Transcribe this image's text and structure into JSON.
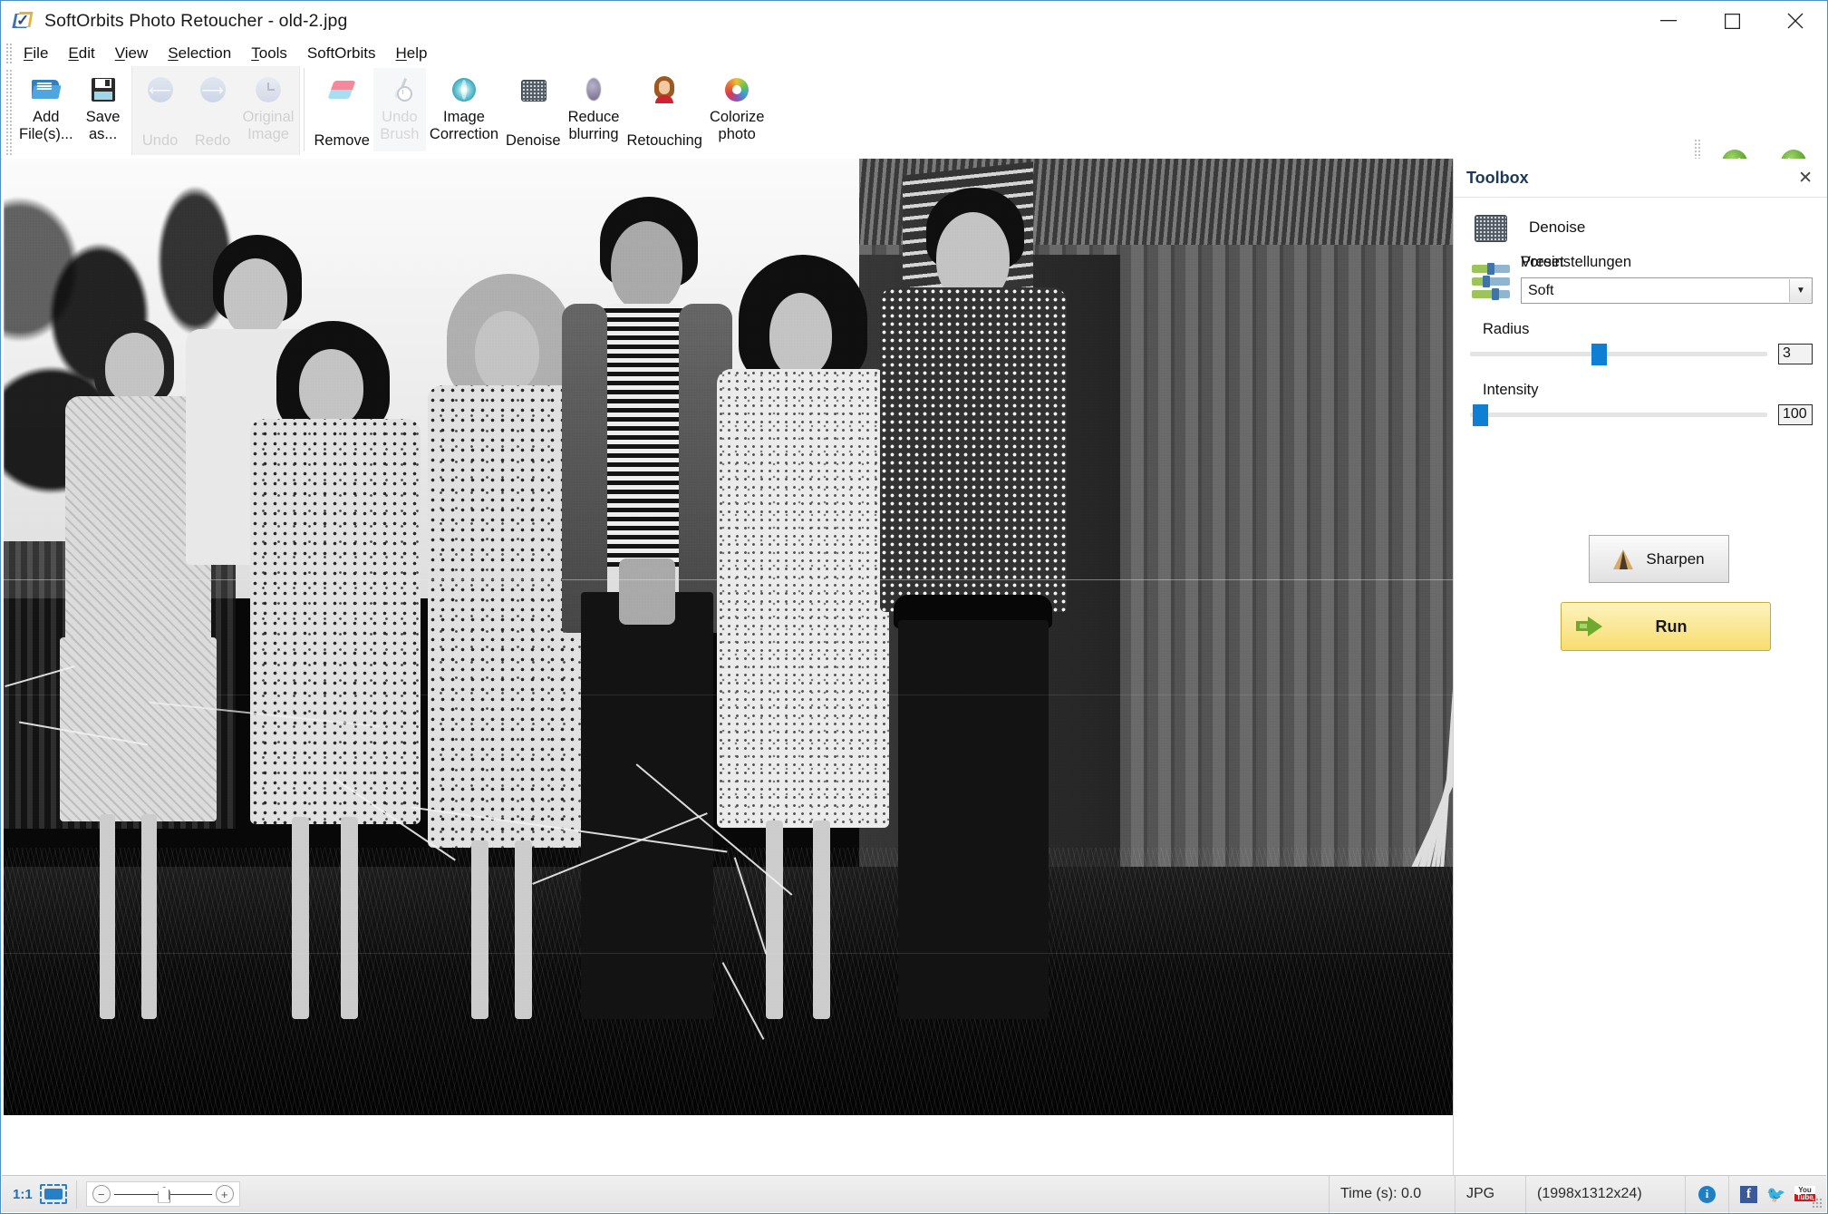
{
  "window": {
    "title": "SoftOrbits Photo Retoucher - old-2.jpg",
    "app_icon": "softorbits-logo-icon",
    "minimize": "—",
    "maximize": "☐",
    "close": "✕"
  },
  "menu": {
    "items": [
      {
        "label": "File",
        "accel": "F"
      },
      {
        "label": "Edit",
        "accel": "E"
      },
      {
        "label": "View",
        "accel": "V"
      },
      {
        "label": "Selection",
        "accel": "S"
      },
      {
        "label": "Tools",
        "accel": "T"
      },
      {
        "label": "SoftOrbits",
        "accel": ""
      },
      {
        "label": "Help",
        "accel": "H"
      }
    ]
  },
  "toolbar": {
    "buttons": [
      {
        "label": "Add\nFile(s)...",
        "line1": "Add",
        "line2": "File(s)...",
        "icon": "open-folder-icon",
        "disabled": false
      },
      {
        "label": "Save as...",
        "line1": "Save",
        "line2": "as...",
        "icon": "floppy-save-icon",
        "disabled": false
      },
      {
        "label": "Undo",
        "line1": "",
        "line2": "Undo",
        "icon": "undo-arrow-icon",
        "disabled": true
      },
      {
        "label": "Redo",
        "line1": "",
        "line2": "Redo",
        "icon": "redo-arrow-icon",
        "disabled": true
      },
      {
        "label": "Original Image",
        "line1": "Original",
        "line2": "Image",
        "icon": "history-clock-icon",
        "disabled": true
      },
      {
        "label": "Remove",
        "line1": "",
        "line2": "Remove",
        "icon": "eraser-icon",
        "disabled": false
      },
      {
        "label": "Undo Brush",
        "line1": "Undo",
        "line2": "Brush",
        "icon": "undo-brush-icon",
        "disabled": true
      },
      {
        "label": "Image Correction",
        "line1": "Image",
        "line2": "Correction",
        "icon": "image-correction-gem-icon",
        "disabled": false
      },
      {
        "label": "Denoise",
        "line1": "",
        "line2": "Denoise",
        "icon": "denoise-noise-icon",
        "disabled": false
      },
      {
        "label": "Reduce blurring",
        "line1": "Reduce",
        "line2": "blurring",
        "icon": "reduce-blur-icon",
        "disabled": false
      },
      {
        "label": "Retouching",
        "line1": "",
        "line2": "Retouching",
        "icon": "retouching-portrait-icon",
        "disabled": false
      },
      {
        "label": "Colorize photo",
        "line1": "Colorize",
        "line2": "photo",
        "icon": "colorize-wheel-icon",
        "disabled": false
      }
    ],
    "nav": [
      {
        "label": "Previous",
        "icon": "nav-previous-green-icon",
        "glyph": "◀"
      },
      {
        "label": "Next",
        "icon": "nav-next-green-icon",
        "glyph": "▶"
      }
    ],
    "collapse_glyph": "▼"
  },
  "toolbox": {
    "title": "Toolbox",
    "close_glyph": "✕",
    "tool_name": "Denoise",
    "tool_icon": "denoise-noise-icon",
    "preset_icon": "sliders-preset-icon",
    "preset_label_en": "Preset",
    "preset_label_de": "Voreinstellungen",
    "preset_value": "Soft",
    "preset_arrow": "▼",
    "sliders": [
      {
        "label": "Radius",
        "value": "3",
        "pos_pct": 40
      },
      {
        "label": "Intensity",
        "value": "100",
        "pos_pct": 2
      }
    ],
    "sharpen_button": "Sharpen",
    "sharpen_icon": "sharpen-triangle-icon",
    "run_button": "Run",
    "run_icon": "green-arrow-run-icon"
  },
  "statusbar": {
    "zoom_ratio": "1:1",
    "fit_icon": "fit-to-window-icon",
    "zoom_out_glyph": "−",
    "zoom_in_glyph": "+",
    "time_label": "Time (s): 0.0",
    "format": "JPG",
    "dimensions": "(1998x1312x24)",
    "info_icon": "info-icon",
    "facebook_icon": "facebook-icon",
    "twitter_icon": "twitter-icon",
    "youtube_icon": "youtube-icon",
    "facebook_glyph": "f",
    "twitter_glyph": "❦",
    "youtube_top": "You",
    "youtube_bottom": "Tube"
  },
  "canvas": {
    "image_name": "old-2.jpg",
    "description": "Black and white vintage group photograph of seven people standing outdoors in front of a wooden barn with leaning poles"
  }
}
